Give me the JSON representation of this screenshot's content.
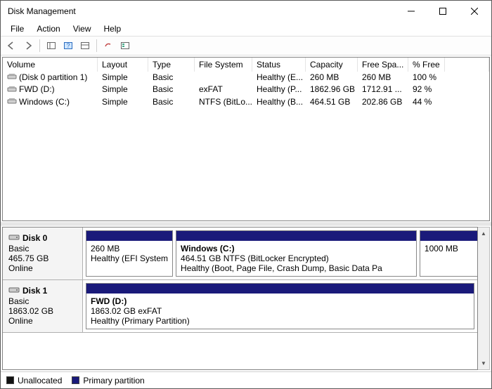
{
  "window": {
    "title": "Disk Management"
  },
  "menu": {
    "file": "File",
    "action": "Action",
    "view": "View",
    "help": "Help"
  },
  "columns": [
    "Volume",
    "Layout",
    "Type",
    "File System",
    "Status",
    "Capacity",
    "Free Spa...",
    "% Free"
  ],
  "volumes": [
    {
      "name": "(Disk 0 partition 1)",
      "layout": "Simple",
      "type": "Basic",
      "fs": "",
      "status": "Healthy (E...",
      "capacity": "260 MB",
      "free": "260 MB",
      "pct": "100 %"
    },
    {
      "name": "FWD (D:)",
      "layout": "Simple",
      "type": "Basic",
      "fs": "exFAT",
      "status": "Healthy (P...",
      "capacity": "1862.96 GB",
      "free": "1712.91 ...",
      "pct": "92 %"
    },
    {
      "name": "Windows (C:)",
      "layout": "Simple",
      "type": "Basic",
      "fs": "NTFS (BitLo...",
      "status": "Healthy (B...",
      "capacity": "464.51 GB",
      "free": "202.86 GB",
      "pct": "44 %"
    }
  ],
  "disks": [
    {
      "name": "Disk 0",
      "kind": "Basic",
      "size": "465.75 GB",
      "state": "Online",
      "partitions": [
        {
          "widthPct": 18,
          "title": "",
          "line1": "260 MB",
          "line2": "Healthy (EFI System"
        },
        {
          "widthPct": 62,
          "title": "Windows  (C:)",
          "line1": "464.51 GB NTFS (BitLocker Encrypted)",
          "line2": "Healthy (Boot, Page File, Crash Dump, Basic Data Pa"
        },
        {
          "widthPct": 20,
          "title": "",
          "line1": "1000 MB",
          "line2": ""
        }
      ]
    },
    {
      "name": "Disk 1",
      "kind": "Basic",
      "size": "1863.02 GB",
      "state": "Online",
      "partitions": [
        {
          "widthPct": 100,
          "title": "FWD  (D:)",
          "line1": "1863.02 GB exFAT",
          "line2": "Healthy (Primary Partition)"
        }
      ]
    }
  ],
  "legend": {
    "unallocated": "Unallocated",
    "primary": "Primary partition"
  }
}
